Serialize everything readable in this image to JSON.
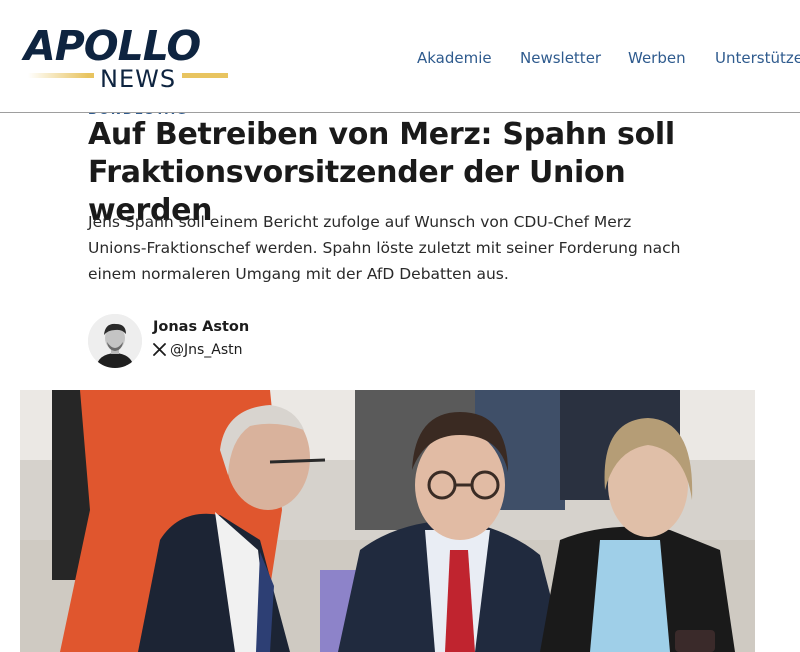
{
  "brand": {
    "logo_main": "APOLLO",
    "logo_sub": "NEWS",
    "colors": {
      "navy": "#0e2440",
      "gold": "#e8c460",
      "link": "#2f5b8e"
    }
  },
  "nav": {
    "items": [
      {
        "label": "Akademie"
      },
      {
        "label": "Newsletter"
      },
      {
        "label": "Werben"
      },
      {
        "label": "Unterstützen"
      }
    ]
  },
  "article": {
    "category": "BUNDESTAG",
    "headline": "Auf Betreiben von Merz: Spahn soll Fraktionsvorsitzender der Union werden",
    "lede": "Jens Spahn soll einem Bericht zufolge auf Wunsch von CDU-Chef Merz Unions-Fraktionschef werden. Spahn löste zuletzt mit seiner Forderung nach einem normaleren Umgang mit der AfD Debatten aus.",
    "author": {
      "name": "Jonas Aston",
      "handle": "@Jns_Astn",
      "social_icon": "x-logo-icon"
    }
  }
}
